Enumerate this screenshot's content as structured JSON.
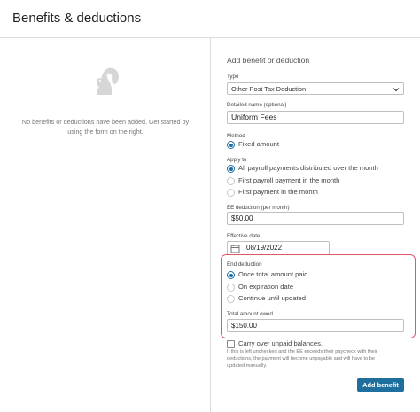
{
  "header": {
    "title": "Benefits & deductions"
  },
  "empty_state": {
    "icon": "squirrel-icon",
    "message_line1": "No benefits or deductions have been added. Get started by",
    "message_line2": "using the form on the right."
  },
  "form": {
    "section_title": "Add benefit or deduction",
    "type": {
      "label": "Type",
      "value": "Other Post Tax Deduction"
    },
    "detailed_name": {
      "label": "Detailed name (optional)",
      "value": "Uniform Fees"
    },
    "method": {
      "label": "Method",
      "options": [
        {
          "label": "Fixed amount",
          "selected": true
        }
      ]
    },
    "apply_to": {
      "label": "Apply to",
      "options": [
        {
          "label": "All payroll payments distributed over the month",
          "selected": true
        },
        {
          "label": "First payroll payment in the month",
          "selected": false
        },
        {
          "label": "First payment in the month",
          "selected": false
        }
      ]
    },
    "ee_deduction": {
      "label": "EE deduction (per month)",
      "value": "$50.00"
    },
    "effective_date": {
      "label": "Effective date",
      "value": "08/19/2022"
    },
    "end_deduction": {
      "label": "End deduction",
      "options": [
        {
          "label": "Once total amount paid",
          "selected": true
        },
        {
          "label": "On expiration date",
          "selected": false
        },
        {
          "label": "Continue until updated",
          "selected": false
        }
      ]
    },
    "total_amount_owed": {
      "label": "Total amount owed",
      "value": "$150.00"
    },
    "carry_over": {
      "label": "Carry over unpaid balances.",
      "checked": false,
      "help_line1": "If this is left unchecked and the EE exceeds their paycheck with their",
      "help_line2": "deductions, the payment will become unpayable and will have to be",
      "help_line3": "updated manually."
    },
    "submit_label": "Add benefit"
  },
  "colors": {
    "accent": "#1f6f9e",
    "highlight_border": "#e0576a"
  }
}
